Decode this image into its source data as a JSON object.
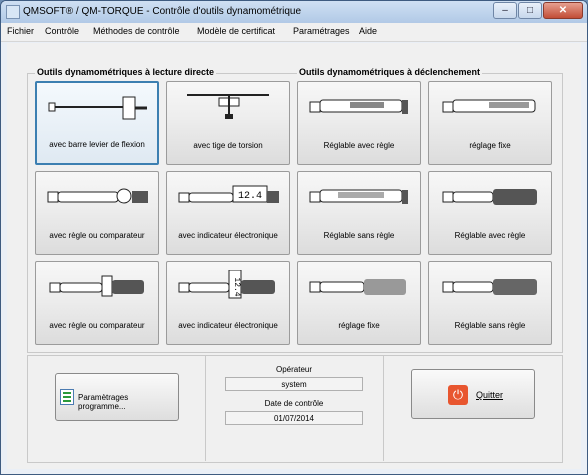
{
  "window": {
    "title": "QMSOFT® / QM-TORQUE - Contrôle d'outils dynamométrique",
    "min": "–",
    "max": "□",
    "close": "✕"
  },
  "menu": [
    "Fichier",
    "Contrôle",
    "Méthodes de contrôle",
    "Modèle de certificat",
    "Paramétrages",
    "Aide"
  ],
  "groups": {
    "direct": "Outils dynamométriques à lecture directe",
    "declench": "Outils dynamométriques à déclenchement"
  },
  "tiles": {
    "t1": "avec barre levier de flexion",
    "t2": "avec tige de torsion",
    "t3": "Réglable avec règle",
    "t4": "réglage fixe",
    "t5": "avec règle ou comparateur",
    "t6": "avec indicateur électronique",
    "t7": "Réglable sans règle",
    "t8": "Réglable avec règle",
    "t9": "avec règle ou comparateur",
    "t10": "avec indicateur électronique",
    "t11": "réglage fixe",
    "t12": "Réglable sans règle"
  },
  "display_values": {
    "horizontal": "12.4",
    "vertical": "12.4"
  },
  "bottom": {
    "settings_button": "Paramètrages programme...",
    "operator_label": "Opérateur",
    "operator_value": "system",
    "date_label": "Date de contrôle",
    "date_value": "01/07/2014",
    "quit_button": "Quitter"
  },
  "colors": {
    "selected_border": "#3c7fb1",
    "quit_icon": "#e8562f"
  }
}
